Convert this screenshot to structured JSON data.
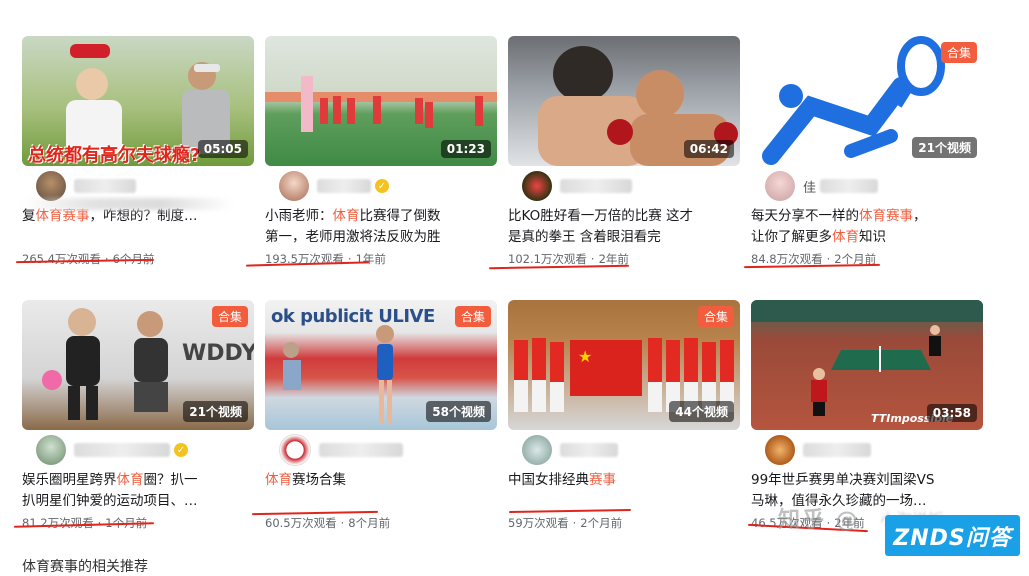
{
  "cards": [
    {
      "duration": "05:05",
      "tag": "",
      "title_parts": [
        "复",
        "体育赛事",
        "，咋想的？制度…"
      ],
      "views": "265.4万次观看",
      "time": "6个月前",
      "caption": "总统都有高尔夫球瘾?",
      "verified": false,
      "author_initial": ""
    },
    {
      "duration": "01:23",
      "tag": "",
      "title_parts": [
        "小雨老师：",
        "体育",
        "比赛得了倒数"
      ],
      "title_line2": "第一，老师用激将法反败为胜",
      "views": "193.5万次观看",
      "time": "1年前",
      "verified": true,
      "author_initial": ""
    },
    {
      "duration": "06:42",
      "tag": "",
      "title_parts": [
        "比KO胜好看一万倍的比赛 这才",
        "",
        ""
      ],
      "title_line2": "是真的拳王 含着眼泪看完",
      "views": "102.1万次观看",
      "time": "2年前",
      "verified": false,
      "author_initial": ""
    },
    {
      "duration": "21个视频",
      "tag": "合集",
      "title_parts": [
        "每天分享不一样的",
        "体育赛事",
        "，"
      ],
      "title_line2_parts": [
        "让你了解更多",
        "体育",
        "知识"
      ],
      "views": "84.8万次观看",
      "time": "2个月前",
      "verified": false,
      "author_initial": "佳"
    },
    {
      "duration": "21个视频",
      "tag": "合集",
      "title_parts": [
        "娱乐圈明星跨界",
        "体育",
        "圈？扒一"
      ],
      "title_line2": "扒明星们钟爱的运动项目、…",
      "views": "81.2万次观看",
      "time": "1个月前",
      "verified": true,
      "author_initial": ""
    },
    {
      "duration": "58个视频",
      "tag": "合集",
      "title_parts": [
        "",
        "体育",
        "赛场合集"
      ],
      "views": "60.5万次观看",
      "time": "8个月前",
      "caption": "ok publicit ULIVE",
      "verified": false,
      "author_initial": ""
    },
    {
      "duration": "44个视频",
      "tag": "合集",
      "title_parts": [
        "中国女排经典",
        "赛事",
        ""
      ],
      "views": "59万次观看",
      "time": "2个月前",
      "verified": false,
      "author_initial": ""
    },
    {
      "duration": "03:58",
      "tag": "",
      "title_parts": [
        "99年世乒赛男单决赛刘国梁VS",
        "",
        ""
      ],
      "title_line2": "马琳，值得永久珍藏的一场…",
      "views": "46.5万次观看",
      "time": "2年前",
      "caption": "TTImpossible",
      "verified": false,
      "author_initial": ""
    }
  ],
  "watermark": {
    "zhihu": "知乎 @",
    "zhihu_rest": "小淘说饭",
    "logo": "ZNDS问答"
  },
  "bottom_text": "体育赛事的相关推荐",
  "colors": {
    "highlight": "#f25d3e",
    "underline": "#e0261c",
    "logo_bg": "#1aa0e6"
  }
}
